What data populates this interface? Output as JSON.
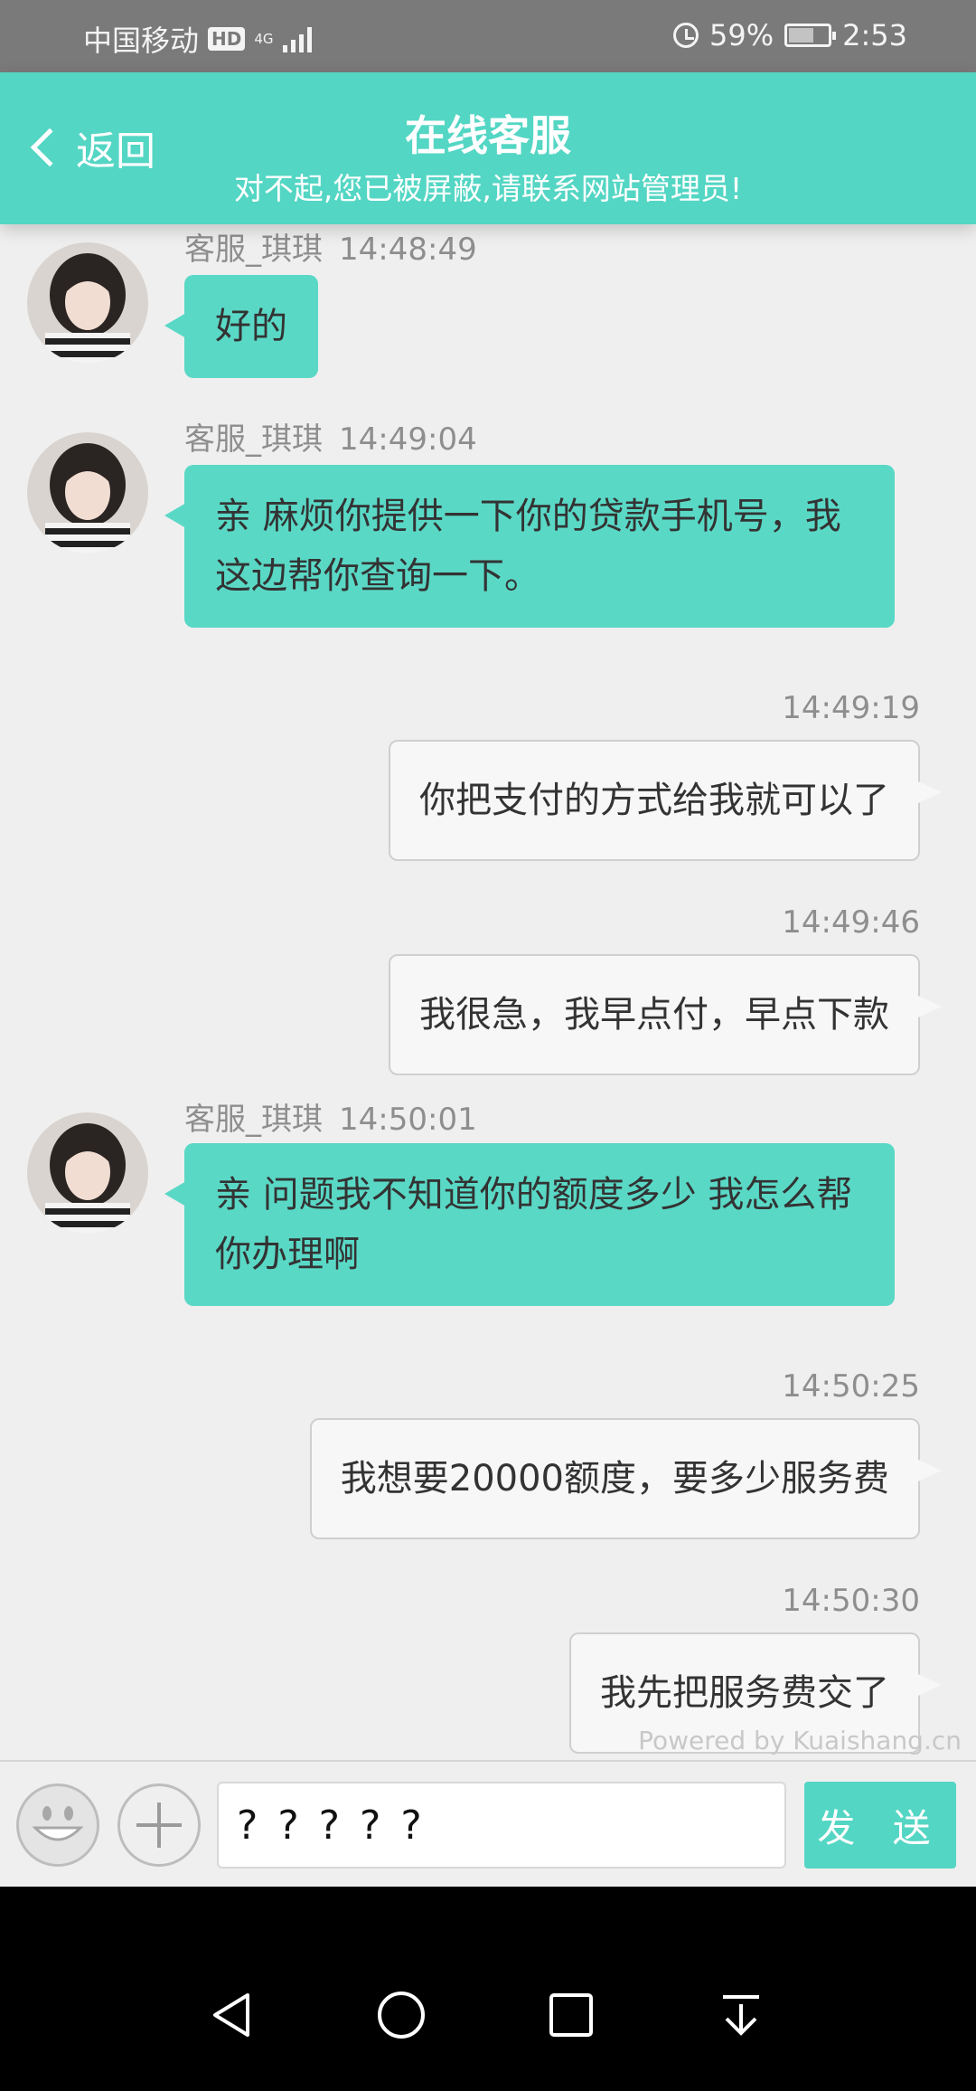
{
  "status_bar": {
    "carrier": "中国移动",
    "hd": "HD",
    "network": "4G",
    "battery_percent": "59%",
    "battery_level": 0.59,
    "time": "2:53"
  },
  "header": {
    "back_label": "返回",
    "title": "在线客服",
    "subtitle": "对不起,您已被屏蔽,请联系网站管理员!"
  },
  "messages": [
    {
      "from": "agent",
      "name": "客服_琪琪",
      "time": "14:48:49",
      "text": "好的"
    },
    {
      "from": "agent",
      "name": "客服_琪琪",
      "time": "14:49:04",
      "text": "亲 麻烦你提供一下你的贷款手机号，我这边帮你查询一下。"
    },
    {
      "from": "user",
      "time": "14:49:19",
      "text": "你把支付的方式给我就可以了"
    },
    {
      "from": "user",
      "time": "14:49:46",
      "text": "我很急，我早点付，早点下款"
    },
    {
      "from": "agent",
      "name": "客服_琪琪",
      "time": "14:50:01",
      "text": "亲 问题我不知道你的额度多少 我怎么帮你办理啊"
    },
    {
      "from": "user",
      "time": "14:50:25",
      "text": "我想要20000额度，要多少服务费"
    },
    {
      "from": "user",
      "time": "14:50:30",
      "text": "我先把服务费交了"
    }
  ],
  "watermark": "Powered by Kuaishang.cn",
  "input": {
    "value": "? ? ? ? ?",
    "send_label": "发 送"
  },
  "nav": [
    "back-nav",
    "home-nav",
    "recents-nav",
    "notification-nav"
  ]
}
